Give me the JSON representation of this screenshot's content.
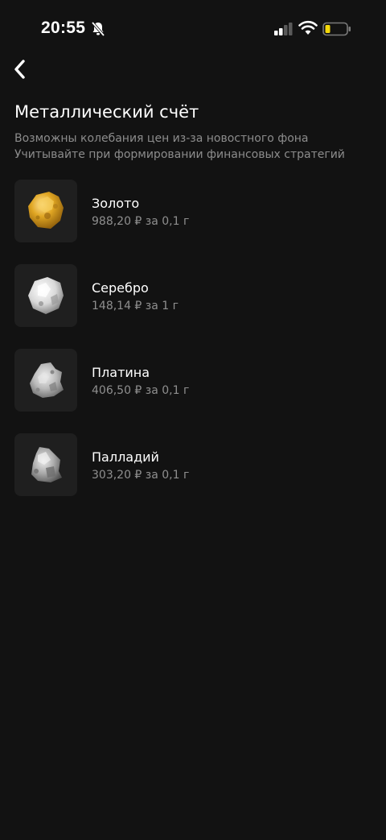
{
  "status_bar": {
    "time": "20:55",
    "icons": [
      "bell-slash-icon",
      "cellular-signal-icon",
      "wifi-icon",
      "battery-low-icon"
    ],
    "battery_color": "#f5d90a"
  },
  "header": {
    "back_icon": "chevron-left-icon",
    "title": "Металлический счёт",
    "subtitle_line1": "Возможны колебания цен из-за новостного фона",
    "subtitle_line2": "Учитывайте при формировании финансовых стратегий"
  },
  "metals": [
    {
      "name": "Золото",
      "price": "988,20 ₽ за 0,1 г",
      "icon": "gold-nugget-icon"
    },
    {
      "name": "Серебро",
      "price": "148,14 ₽ за 1 г",
      "icon": "silver-nugget-icon"
    },
    {
      "name": "Платина",
      "price": "406,50 ₽ за 0,1 г",
      "icon": "platinum-nugget-icon"
    },
    {
      "name": "Палладий",
      "price": "303,20 ₽ за 0,1 г",
      "icon": "palladium-nugget-icon"
    }
  ],
  "colors": {
    "background": "#121212",
    "card": "#1f1f1f",
    "secondary_text": "#8c8c8c",
    "gold": "#d9a520",
    "silver": "#e6e6e6"
  }
}
